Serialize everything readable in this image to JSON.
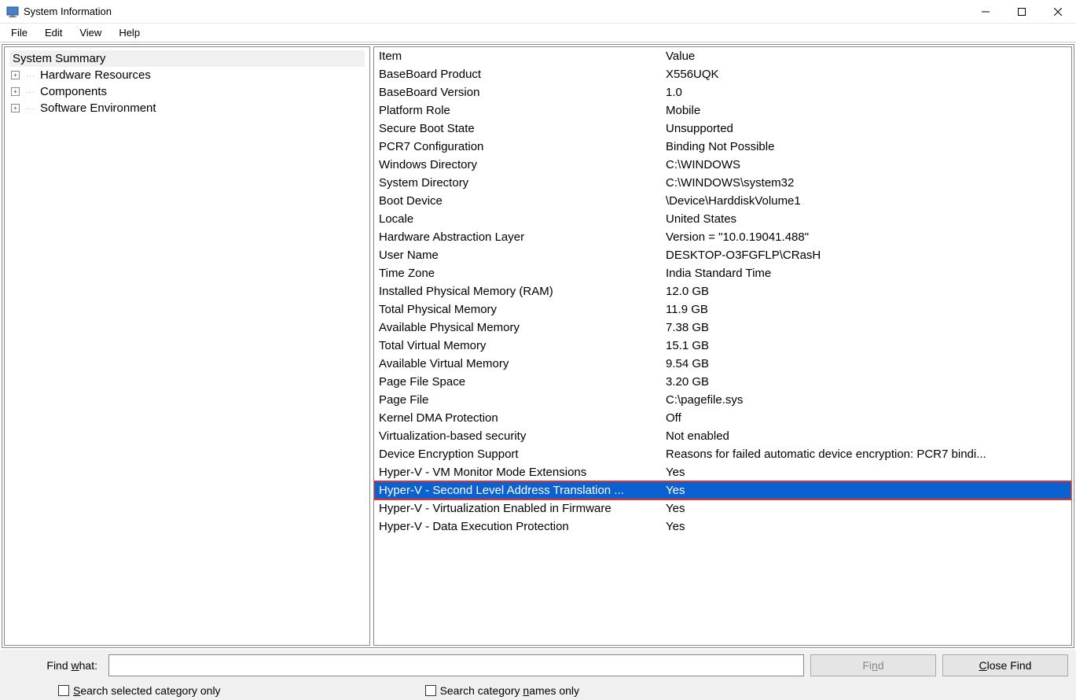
{
  "window": {
    "title": "System Information"
  },
  "menu": {
    "file": "File",
    "edit": "Edit",
    "view": "View",
    "help": "Help"
  },
  "tree": {
    "summary": "System Summary",
    "nodes": [
      {
        "label": "Hardware Resources"
      },
      {
        "label": "Components"
      },
      {
        "label": "Software Environment"
      }
    ]
  },
  "table": {
    "header": {
      "item": "Item",
      "value": "Value"
    },
    "rows": [
      {
        "item": "BaseBoard Product",
        "value": "X556UQK"
      },
      {
        "item": "BaseBoard Version",
        "value": "1.0"
      },
      {
        "item": "Platform Role",
        "value": "Mobile"
      },
      {
        "item": "Secure Boot State",
        "value": "Unsupported"
      },
      {
        "item": "PCR7 Configuration",
        "value": "Binding Not Possible"
      },
      {
        "item": "Windows Directory",
        "value": "C:\\WINDOWS"
      },
      {
        "item": "System Directory",
        "value": "C:\\WINDOWS\\system32"
      },
      {
        "item": "Boot Device",
        "value": "\\Device\\HarddiskVolume1"
      },
      {
        "item": "Locale",
        "value": "United States"
      },
      {
        "item": "Hardware Abstraction Layer",
        "value": "Version = \"10.0.19041.488\""
      },
      {
        "item": "User Name",
        "value": "DESKTOP-O3FGFLP\\CRasH"
      },
      {
        "item": "Time Zone",
        "value": "India Standard Time"
      },
      {
        "item": "Installed Physical Memory (RAM)",
        "value": "12.0 GB"
      },
      {
        "item": "Total Physical Memory",
        "value": "11.9 GB"
      },
      {
        "item": "Available Physical Memory",
        "value": "7.38 GB"
      },
      {
        "item": "Total Virtual Memory",
        "value": "15.1 GB"
      },
      {
        "item": "Available Virtual Memory",
        "value": "9.54 GB"
      },
      {
        "item": "Page File Space",
        "value": "3.20 GB"
      },
      {
        "item": "Page File",
        "value": "C:\\pagefile.sys"
      },
      {
        "item": "Kernel DMA Protection",
        "value": "Off"
      },
      {
        "item": "Virtualization-based security",
        "value": "Not enabled"
      },
      {
        "item": "Device Encryption Support",
        "value": "Reasons for failed automatic device encryption: PCR7 bindi..."
      },
      {
        "item": "Hyper-V - VM Monitor Mode Extensions",
        "value": "Yes"
      },
      {
        "item": "Hyper-V - Second Level Address Translation ...",
        "value": "Yes",
        "selected": true,
        "highlight": true
      },
      {
        "item": "Hyper-V - Virtualization Enabled in Firmware",
        "value": "Yes"
      },
      {
        "item": "Hyper-V - Data Execution Protection",
        "value": "Yes"
      }
    ]
  },
  "footer": {
    "find_label_pre": "Find ",
    "find_label_ul": "w",
    "find_label_post": "hat:",
    "find_button_prefix": "Fi",
    "find_button_ul": "n",
    "find_button_suffix": "d",
    "close_find_ul": "C",
    "close_find_suffix": "lose Find",
    "cb1_ul": "S",
    "cb1_suffix": "earch selected category only",
    "cb2_prefix": "Search category ",
    "cb2_ul": "n",
    "cb2_suffix": "ames only"
  }
}
